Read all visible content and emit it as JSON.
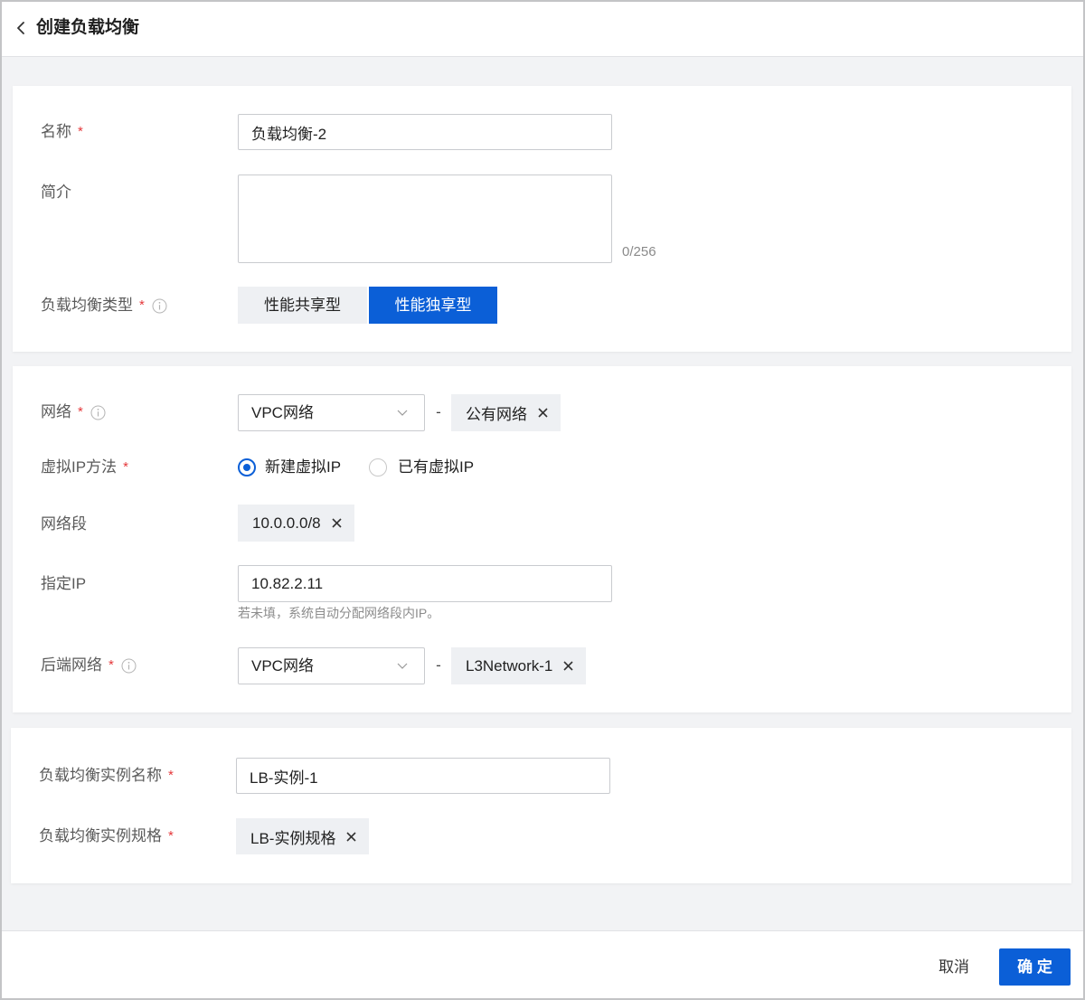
{
  "header": {
    "title": "创建负载均衡",
    "back_icon": "chevron-left-icon"
  },
  "basic": {
    "name": {
      "label": "名称",
      "required": "*",
      "value": "负载均衡-2"
    },
    "description": {
      "label": "简介",
      "counter": "0/256"
    },
    "lb_type": {
      "label": "负载均衡类型",
      "required": "*",
      "info_icon": "info-icon",
      "options": [
        "性能共享型",
        "性能独享型"
      ],
      "selected_index": 1
    }
  },
  "network": {
    "network": {
      "label": "网络",
      "required": "*",
      "info_icon": "info-icon",
      "select_value": "VPC网络",
      "separator": "-",
      "tag": "公有网络"
    },
    "vip_method": {
      "label": "虚拟IP方法",
      "required": "*",
      "options": [
        {
          "label": "新建虚拟IP"
        },
        {
          "label": "已有虚拟IP"
        }
      ],
      "checked_index": 0
    },
    "segment": {
      "label": "网络段",
      "tag": "10.0.0.0/8"
    },
    "specified_ip": {
      "label": "指定IP",
      "value": "10.82.2.11",
      "hint": "若未填，系统自动分配网络段内IP。"
    },
    "backend_network": {
      "label": "后端网络",
      "required": "*",
      "info_icon": "info-icon",
      "select_value": "VPC网络",
      "separator": "-",
      "tag": "L3Network-1"
    }
  },
  "instance": {
    "name": {
      "label": "负载均衡实例名称",
      "required": "*",
      "value": "LB-实例-1"
    },
    "spec": {
      "label": "负载均衡实例规格",
      "required": "*",
      "tag": "LB-实例规格"
    }
  },
  "footer": {
    "cancel": "取消",
    "confirm": "确 定"
  },
  "icons": {
    "tag_remove": "close-icon",
    "select_arrow": "chevron-down-icon"
  },
  "colors": {
    "primary": "#0b5fd7",
    "required": "#e5383b",
    "page_bg": "#f2f3f5",
    "tag_bg": "#eef0f3",
    "label": "#5a5a5a"
  }
}
